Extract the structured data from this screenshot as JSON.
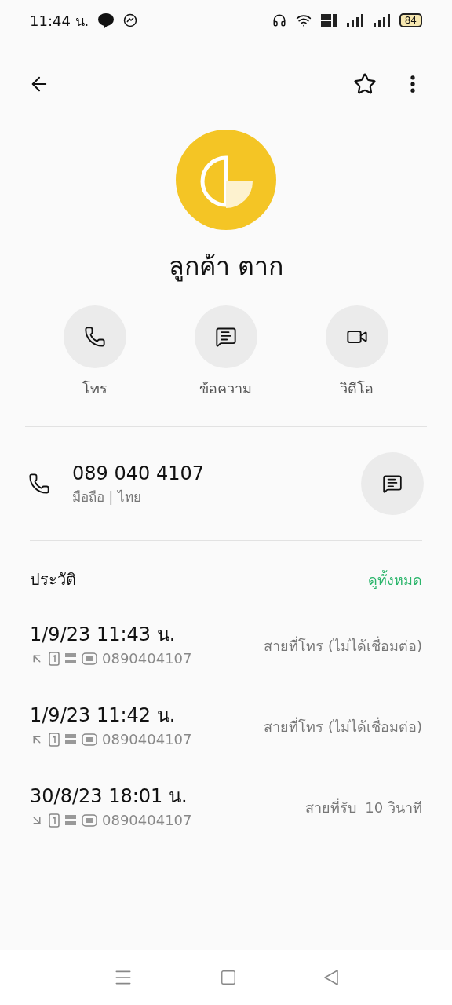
{
  "status_bar": {
    "time": "11:44 น.",
    "battery": "84"
  },
  "contact": {
    "name": "ลูกค้า ตาก",
    "starred": false
  },
  "actions": [
    {
      "kind": "call",
      "label": "โทร"
    },
    {
      "kind": "message",
      "label": "ข้อความ"
    },
    {
      "kind": "video",
      "label": "วิดีโอ"
    }
  ],
  "phone": {
    "number": "089 040 4107",
    "detail": "มือถือ | ไทย"
  },
  "history": {
    "title": "ประวัติ",
    "view_all": "ดูทั้งหมด",
    "calls": [
      {
        "time": "1/9/23 11:43 น.",
        "kind": "outgoing",
        "number": "0890404107",
        "status": "สายที่โทร (ไม่ได้เชื่อมต่อ)"
      },
      {
        "time": "1/9/23 11:42 น.",
        "kind": "outgoing",
        "number": "0890404107",
        "status": "สายที่โทร (ไม่ได้เชื่อมต่อ)"
      },
      {
        "time": "30/8/23 18:01 น.",
        "kind": "incoming",
        "number": "0890404107",
        "status": "สายที่รับ  10 วินาที"
      }
    ]
  }
}
